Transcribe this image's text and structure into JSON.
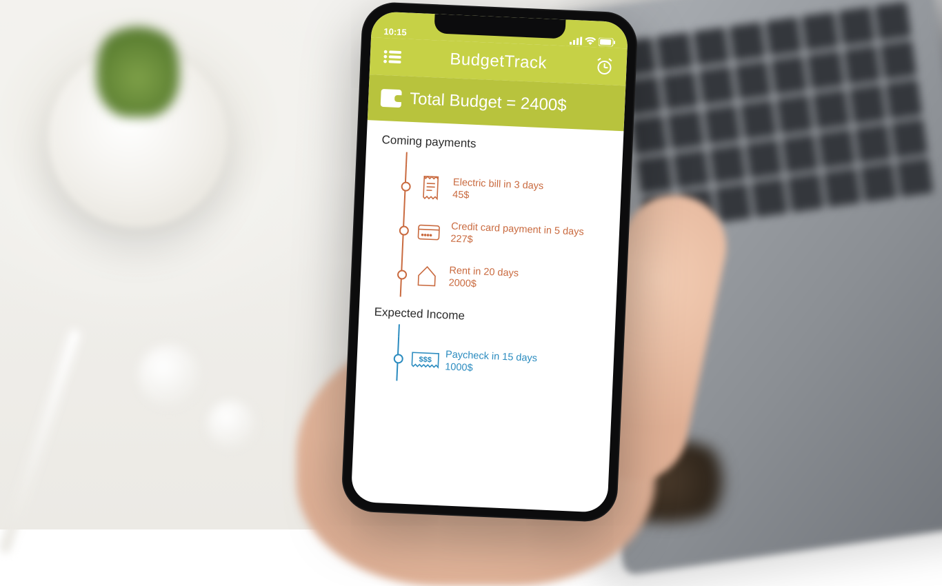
{
  "statusbar": {
    "time": "10:15"
  },
  "header": {
    "app_title": "BudgetTrack",
    "menu_icon": "menu-list-icon",
    "alarm_icon": "alarm-clock-icon"
  },
  "banner": {
    "label": "Total Budget = 2400$",
    "wallet_icon": "wallet-icon"
  },
  "sections": {
    "payments_title": "Coming payments",
    "income_title": "Expected Income"
  },
  "payments": [
    {
      "icon": "receipt-icon",
      "title": "Electric bill in 3 days",
      "amount": "45$"
    },
    {
      "icon": "credit-card-icon",
      "title": "Credit card payment in 5 days",
      "amount": "227$"
    },
    {
      "icon": "house-icon",
      "title": "Rent in 20 days",
      "amount": "2000$"
    }
  ],
  "income": [
    {
      "icon": "paycheck-icon",
      "title": "Paycheck in 15 days",
      "amount": "1000$"
    }
  ],
  "colors": {
    "header_bg": "#c6d146",
    "banner_bg": "#b8c33d",
    "payment": "#c96a3f",
    "income": "#2a8bbf"
  }
}
